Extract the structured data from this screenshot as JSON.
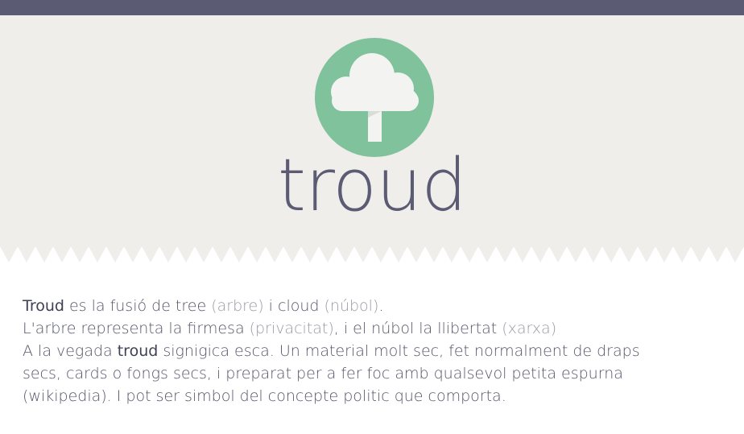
{
  "brand": {
    "name": "troud"
  },
  "colors": {
    "topbar": "#5b5b73",
    "hero_bg": "#efeeea",
    "logo_circle": "#7fc29b",
    "cloud": "#f3f4f2",
    "text": "#55556a"
  },
  "icons": {
    "logo": "tree-cloud-icon"
  },
  "description": {
    "line1": {
      "strong": "Troud",
      "a": " es la fusió de tree ",
      "b": "(arbre)",
      "c": " i cloud ",
      "d": "(núbol)",
      "e": "."
    },
    "line2": {
      "a": "L'arbre representa la firmesa ",
      "b": "(privacitat)",
      "c": ", i el núbol la llibertat ",
      "d": "(xarxa)"
    },
    "line3": {
      "a": "A la vegada ",
      "strong": "troud",
      "b": " signigica esca. Un material molt sec, fet normalment de draps"
    },
    "line4": "secs, cards o fongs secs, i preparat per a fer foc amb qualsevol petita espurna",
    "line5": "(wikipedia). I pot ser simbol del concepte politic que comporta."
  }
}
